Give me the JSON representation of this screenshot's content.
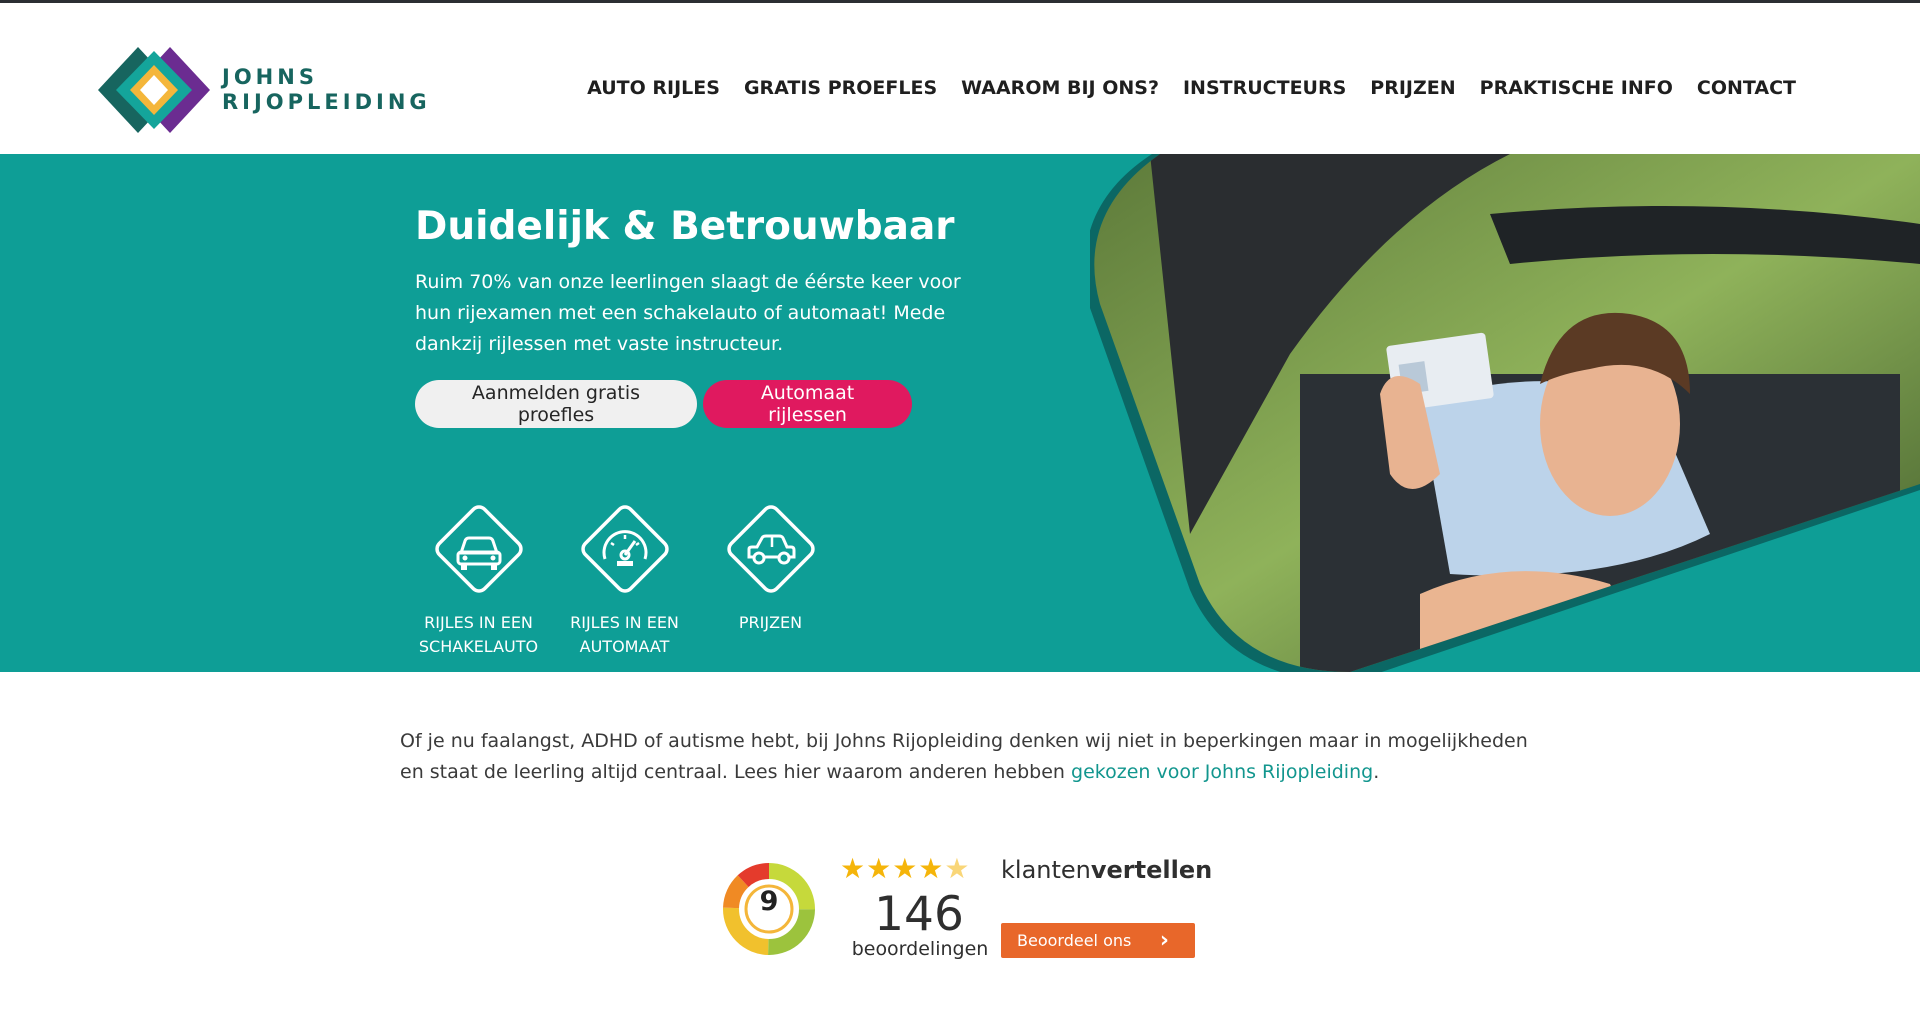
{
  "brand": {
    "name_line1": "JOHNS",
    "name_line2": "RIJOPLEIDING",
    "colors": {
      "teal": "#0e9e96",
      "dark_teal": "#17655f",
      "purple": "#6b2c91",
      "yellow": "#f4b63a",
      "pink": "#e0195f",
      "orange": "#e8672a"
    }
  },
  "nav": {
    "items": [
      {
        "label": "AUTO RIJLES"
      },
      {
        "label": "GRATIS PROEFLES"
      },
      {
        "label": "WAAROM BIJ ONS?"
      },
      {
        "label": "INSTRUCTEURS"
      },
      {
        "label": "PRIJZEN"
      },
      {
        "label": "PRAKTISCHE INFO"
      },
      {
        "label": "CONTACT"
      }
    ]
  },
  "hero": {
    "title": "Duidelijk & Betrouwbaar",
    "text": "Ruim 70% van onze leerlingen slaagt de éérste keer voor hun rijexamen met een schakelauto of automaat! Mede dankzij rijlessen met vaste instructeur.",
    "buttons": {
      "primary": "Aanmelden gratis proefles",
      "secondary": "Automaat rijlessen"
    },
    "features": [
      {
        "icon": "car-front-icon",
        "label_line1": "RIJLES IN EEN",
        "label_line2": "SCHAKELAUTO"
      },
      {
        "icon": "speedometer-icon",
        "label_line1": "RIJLES IN EEN",
        "label_line2": "AUTOMAAT"
      },
      {
        "icon": "car-side-icon",
        "label_line1": "PRIJZEN",
        "label_line2": ""
      }
    ],
    "image": "young man in car holding driving license"
  },
  "intro": {
    "text_before": "Of je nu faalangst, ADHD of autisme hebt, bij Johns Rijopleiding denken wij niet in beperkingen maar in mogelijkheden en staat de leerling altijd centraal. Lees hier waarom anderen hebben ",
    "link": "gekozen voor Johns Rijopleiding",
    "text_after": "."
  },
  "reviews": {
    "score": "9",
    "stars": 4.5,
    "stars_display": "★★★★",
    "count": "146",
    "count_label": "beoordelingen",
    "brand_light": "klanten",
    "brand_bold": "vertellen",
    "button": "Beoordeel ons",
    "button_icon": "chevron-right-icon"
  }
}
